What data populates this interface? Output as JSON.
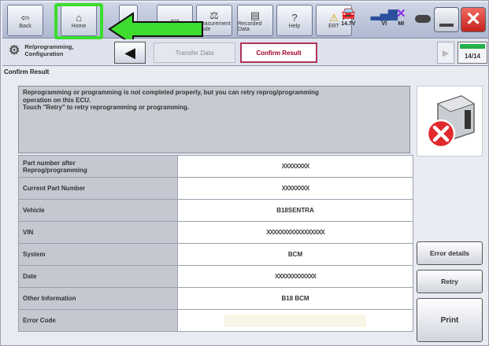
{
  "toolbar": {
    "buttons": [
      {
        "label": "Back",
        "icon": "back-arrow-icon"
      },
      {
        "label": "Home",
        "icon": "home-icon"
      },
      {
        "label": "",
        "icon": "blank-icon"
      },
      {
        "label": "",
        "icon": "screen-capture-icon"
      },
      {
        "label": "Measurement Mode",
        "icon": "measurement-icon"
      },
      {
        "label": "Recorded Data",
        "icon": "recorded-data-icon"
      },
      {
        "label": "Help",
        "icon": "help-icon"
      },
      {
        "label": "ERT",
        "icon": "warning-icon"
      }
    ],
    "status": [
      {
        "label": "14.7V",
        "icon": "car-battery-icon"
      },
      {
        "label": "VI",
        "icon": "signal-bars-icon"
      },
      {
        "label": "MI",
        "icon": "no-connection-icon"
      }
    ]
  },
  "stepbar": {
    "title_line1": "Re/programming,",
    "title_line2": "Configuration",
    "tab_transfer": "Transfer Data",
    "tab_confirm": "Confirm Result",
    "page": "14/14",
    "progress": 1.0
  },
  "section": {
    "title": "Confirm Result",
    "message_line1": "Reprogramming or programming is not completed properly, but you can retry reprog/programming",
    "message_line2": "operation on this ECU.",
    "message_line3": "Touch \"Retry\" to retry reprogramming or programming."
  },
  "table": {
    "rows": [
      {
        "label_line1": "Part number after",
        "label_line2": "Reprog/programming",
        "value": "XXXXXXXX"
      },
      {
        "label_line1": "Current Part Number",
        "label_line2": "",
        "value": "XXXXXXXX"
      },
      {
        "label_line1": "Vehicle",
        "label_line2": "",
        "value": "B18SENTRA"
      },
      {
        "label_line1": "VIN",
        "label_line2": "",
        "value": "XXXXXXXXXXXXXXXXX"
      },
      {
        "label_line1": "System",
        "label_line2": "",
        "value": "BCM"
      },
      {
        "label_line1": "Date",
        "label_line2": "",
        "value": "XXXXXXXXXXXX"
      },
      {
        "label_line1": "Other Information",
        "label_line2": "",
        "value": "B18 BCM"
      },
      {
        "label_line1": "Error Code",
        "label_line2": "",
        "value": ""
      }
    ]
  },
  "side_buttons": {
    "error_details": "Error details",
    "retry": "Retry",
    "print": "Print"
  },
  "colors": {
    "highlight": "#3ddc2f",
    "active_tab": "#b0345a",
    "error_red": "#e0292b"
  }
}
